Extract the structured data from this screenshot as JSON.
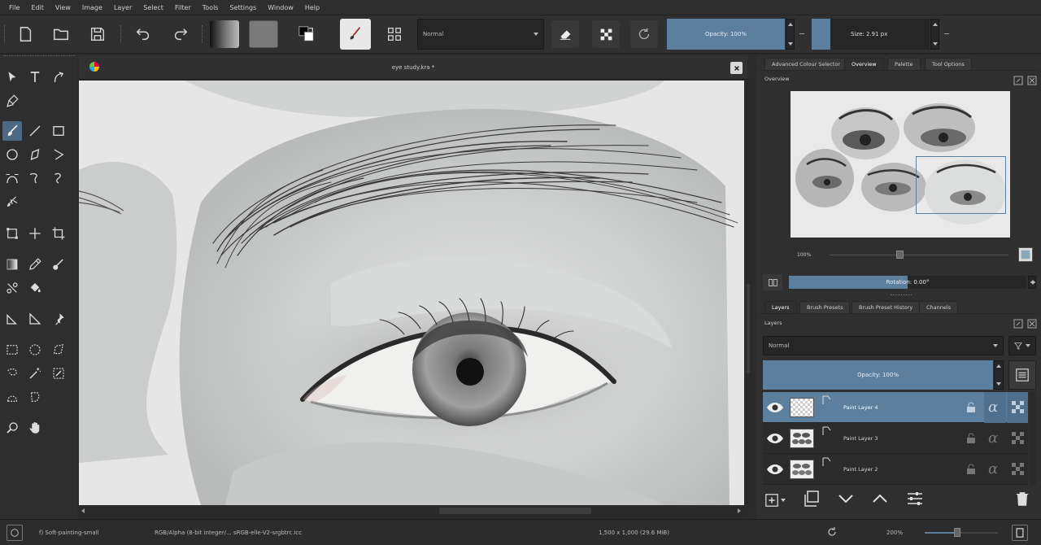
{
  "menu": [
    "File",
    "Edit",
    "View",
    "Image",
    "Layer",
    "Select",
    "Filter",
    "Tools",
    "Settings",
    "Window",
    "Help"
  ],
  "toolbar": {
    "blend_mode": "Normal",
    "opacity_label": "Opacity: 100%",
    "opacity_value": 1.0,
    "size_label": "Size: 2.91 px"
  },
  "document": {
    "title": "eye study.kra *"
  },
  "dock": {
    "tabs": [
      "Advanced Colour Selector",
      "Overview",
      "Palette",
      "Tool Options"
    ],
    "active_tab": "Overview",
    "overview_title": "Overview",
    "zoom_label": "100%",
    "rotation_label": "Rotation: 0.00°",
    "layer_tabs": [
      "Layers",
      "Brush Presets",
      "Brush Preset History",
      "Channels"
    ],
    "layers_title": "Layers",
    "layer_blend_mode": "Normal",
    "layer_opacity_label": "Opacity: 100%",
    "layers": [
      {
        "name": "Paint Layer 4",
        "selected": true
      },
      {
        "name": "Paint Layer 3",
        "selected": false
      },
      {
        "name": "Paint Layer 2",
        "selected": false
      }
    ]
  },
  "status": {
    "brush_preset": "f) Soft-painting-small",
    "color_space": "RGB/Alpha (8-bit integer/... sRGB-elle-V2-srgbtrc.icc",
    "image_size": "1,500 x 1,000 (29.6 MiB)",
    "zoom": "200%"
  },
  "colors": {
    "accent": "#5d7f9e",
    "background": "#2b2b2b"
  }
}
